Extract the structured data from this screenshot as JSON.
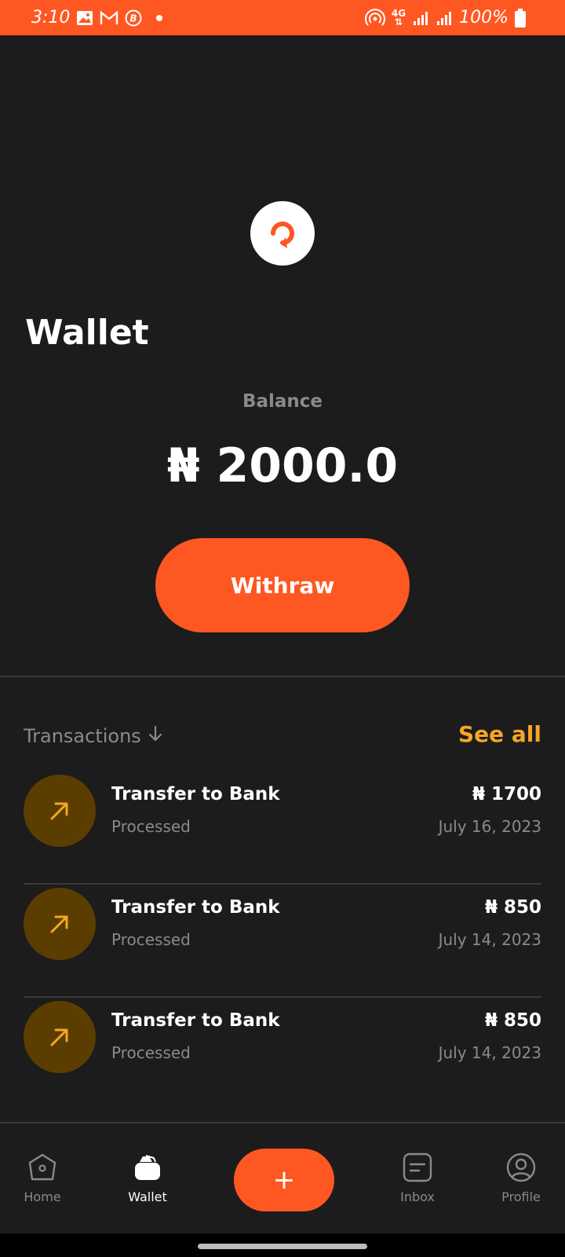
{
  "status_bar": {
    "time": "3:10",
    "battery": "100%",
    "network": "4G",
    "bg_color": "#ff5722"
  },
  "header": {
    "logo_icon": "refresh-icon",
    "title": "Wallet"
  },
  "balance": {
    "label": "Balance",
    "value": "₦ 2000.0"
  },
  "withdraw_button": {
    "label": "Withraw",
    "color": "#ff5722"
  },
  "transactions": {
    "header_label": "Transactions",
    "see_all": "See all",
    "items": [
      {
        "title": "Transfer to Bank",
        "status": "Processed",
        "amount": "₦ 1700",
        "date": "July 16, 2023",
        "icon": "arrow-up-right-icon"
      },
      {
        "title": "Transfer to Bank",
        "status": "Processed",
        "amount": "₦ 850",
        "date": "July 14, 2023",
        "icon": "arrow-up-right-icon"
      },
      {
        "title": "Transfer to Bank",
        "status": "Processed",
        "amount": "₦ 850",
        "date": "July 14, 2023",
        "icon": "arrow-up-right-icon"
      }
    ]
  },
  "nav": {
    "items": [
      {
        "label": "Home",
        "icon": "home-icon",
        "active": false
      },
      {
        "label": "Wallet",
        "icon": "wallet-icon",
        "active": true
      },
      {
        "label": "Inbox",
        "icon": "inbox-icon",
        "active": false
      },
      {
        "label": "Profile",
        "icon": "profile-icon",
        "active": false
      }
    ],
    "fab_label": "+"
  },
  "colors": {
    "accent": "#ff5722",
    "gold": "#f5a623",
    "background": "#1c1c1c"
  }
}
